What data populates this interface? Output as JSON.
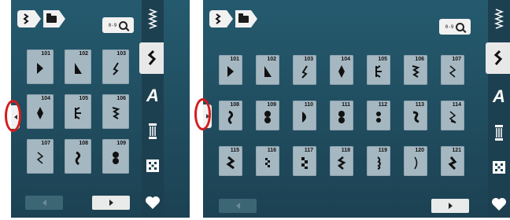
{
  "screens": [
    {
      "header": {
        "search_digits": "0-9"
      },
      "tiles": [
        {
          "num": "101",
          "shape": "tri-right"
        },
        {
          "num": "102",
          "shape": "tri-left-up"
        },
        {
          "num": "103",
          "shape": "hook"
        },
        {
          "num": "104",
          "shape": "diamond"
        },
        {
          "num": "105",
          "shape": "arrow"
        },
        {
          "num": "106",
          "shape": "zigzag"
        },
        {
          "num": "107",
          "shape": "chevron"
        },
        {
          "num": "108",
          "shape": "wave"
        },
        {
          "num": "109",
          "shape": "dots"
        }
      ]
    },
    {
      "header": {
        "search_digits": "0-9"
      },
      "tiles": [
        {
          "num": "101",
          "shape": "tri-right"
        },
        {
          "num": "102",
          "shape": "tri-left-up"
        },
        {
          "num": "103",
          "shape": "hook"
        },
        {
          "num": "104",
          "shape": "diamond"
        },
        {
          "num": "105",
          "shape": "arrow"
        },
        {
          "num": "106",
          "shape": "zigzag"
        },
        {
          "num": "107",
          "shape": "chevron"
        },
        {
          "num": "108",
          "shape": "wave"
        },
        {
          "num": "109",
          "shape": "dots"
        },
        {
          "num": "110",
          "shape": "half-round"
        },
        {
          "num": "111",
          "shape": "dots"
        },
        {
          "num": "112",
          "shape": "dots2"
        },
        {
          "num": "113",
          "shape": "s-curve"
        },
        {
          "num": "114",
          "shape": "slant"
        },
        {
          "num": "115",
          "shape": "bolt"
        },
        {
          "num": "116",
          "shape": "checker"
        },
        {
          "num": "117",
          "shape": "checker2"
        },
        {
          "num": "118",
          "shape": "snake"
        },
        {
          "num": "119",
          "shape": "brace"
        },
        {
          "num": "120",
          "shape": "paren"
        },
        {
          "num": "121",
          "shape": "bolt2"
        }
      ]
    }
  ],
  "sidebar": {
    "items": [
      {
        "icon": "zigzag-stitch-icon"
      },
      {
        "icon": "decorative-stitch-icon"
      },
      {
        "icon": "alphabet-icon",
        "label": "A"
      },
      {
        "icon": "buttonhole-icon"
      },
      {
        "icon": "quilt-icon"
      },
      {
        "icon": "heart-icon"
      }
    ]
  },
  "colors": {
    "screen_bg": "#1f4b5d",
    "tile_bg": "#a5b8c2",
    "highlight_ring": "#d41c1c"
  }
}
